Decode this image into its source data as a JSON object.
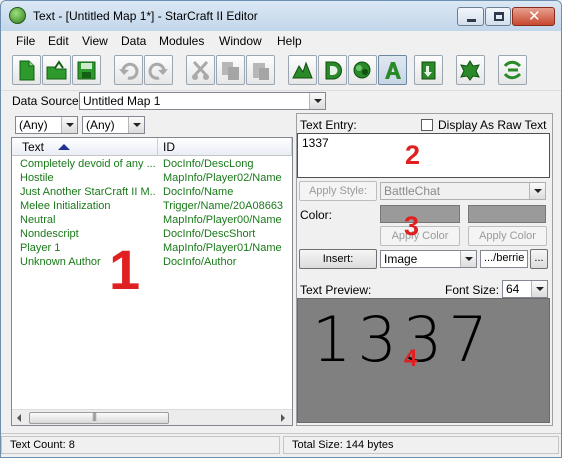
{
  "window": {
    "title": "Text - [Untitled Map 1*] - StarCraft II Editor"
  },
  "menu": [
    "File",
    "Edit",
    "View",
    "Data",
    "Modules",
    "Window",
    "Help"
  ],
  "toolbar_icons": [
    "new-file-icon",
    "open-folder-icon",
    "save-icon",
    "undo-icon",
    "redo-icon",
    "cut-icon",
    "copy-icon",
    "paste-icon",
    "terrain-module-icon",
    "data-module-icon",
    "trigger-module-icon",
    "text-module-icon",
    "import-module-icon",
    "unit-module-icon",
    "ai-module-icon"
  ],
  "data_source": {
    "label": "Data Source:",
    "value": "Untitled Map 1"
  },
  "filters": {
    "first": "(Any)",
    "second": "(Any)"
  },
  "table": {
    "headers": {
      "text": "Text",
      "id": "ID"
    },
    "rows": [
      {
        "text": "Completely devoid of any ...",
        "id": "DocInfo/DescLong"
      },
      {
        "text": "Hostile",
        "id": "MapInfo/Player02/Name"
      },
      {
        "text": "Just Another StarCraft II M...",
        "id": "DocInfo/Name"
      },
      {
        "text": "Melee Initialization",
        "id": "Trigger/Name/20A08663"
      },
      {
        "text": "Neutral",
        "id": "MapInfo/Player00/Name"
      },
      {
        "text": "Nondescript",
        "id": "DocInfo/DescShort"
      },
      {
        "text": "Player 1",
        "id": "MapInfo/Player01/Name"
      },
      {
        "text": "Unknown Author",
        "id": "DocInfo/Author"
      }
    ]
  },
  "editor": {
    "text_entry_label": "Text Entry:",
    "raw_text_label": "Display As Raw Text",
    "text_entry_value": "1337",
    "apply_style_label": "Apply Style:",
    "style_value": "BattleChat",
    "color_label": "Color:",
    "apply_color_1": "Apply Color",
    "apply_color_2": "Apply Color",
    "insert_label": "Insert:",
    "insert_value": "Image",
    "path_value": ".../berrie",
    "browse_label": "...",
    "preview_label": "Text Preview:",
    "font_size_label": "Font Size:",
    "font_size_value": "64",
    "preview_text": "1337"
  },
  "status": {
    "left": "Text Count: 8",
    "right": "Total Size: 144 bytes"
  },
  "annotations": [
    "1",
    "2",
    "3",
    "4"
  ],
  "colors": {
    "list_text": "#1a7a1a",
    "annotation": "#e02020",
    "preview_bg": "#808080",
    "swatch": "#9a9a9a"
  }
}
